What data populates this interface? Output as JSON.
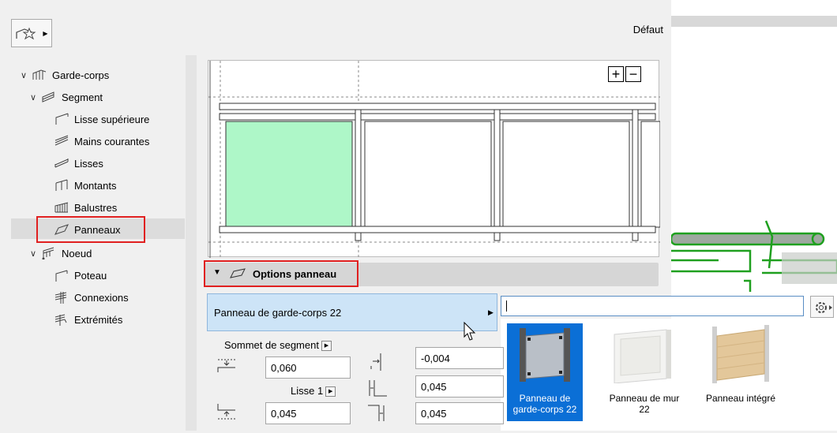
{
  "header": {
    "default_label": "Défaut"
  },
  "tree": {
    "items": [
      {
        "label": "Garde-corps"
      },
      {
        "label": "Segment"
      },
      {
        "label": "Lisse supérieure"
      },
      {
        "label": "Mains courantes"
      },
      {
        "label": "Lisses"
      },
      {
        "label": "Montants"
      },
      {
        "label": "Balustres"
      },
      {
        "label": "Panneaux"
      },
      {
        "label": "Noeud"
      },
      {
        "label": "Poteau"
      },
      {
        "label": "Connexions"
      },
      {
        "label": "Extrémités"
      }
    ]
  },
  "preview": {
    "zoom_in": "+",
    "zoom_out": "−"
  },
  "section": {
    "title": "Options panneau"
  },
  "panel": {
    "selected": "Panneau de garde-corps 22"
  },
  "search": {
    "value": ""
  },
  "gallery": {
    "items": [
      {
        "line1": "Panneau de",
        "line2": "garde-corps 22"
      },
      {
        "line1": "Panneau de mur",
        "line2": "22"
      },
      {
        "line1": "Panneau intégré",
        "line2": ""
      }
    ]
  },
  "params": {
    "sommet_label": "Sommet de segment",
    "lisse_label": "Lisse 1",
    "field1": "0,060",
    "field2": "0,045",
    "field3": "-0,004",
    "field4": "0,045",
    "field5": "0,045"
  },
  "colors": {
    "accent": "#0b6fd6",
    "highlight_red": "#e02020",
    "panel_green": "#aef7c8",
    "selection_blue": "#cde4f7"
  }
}
